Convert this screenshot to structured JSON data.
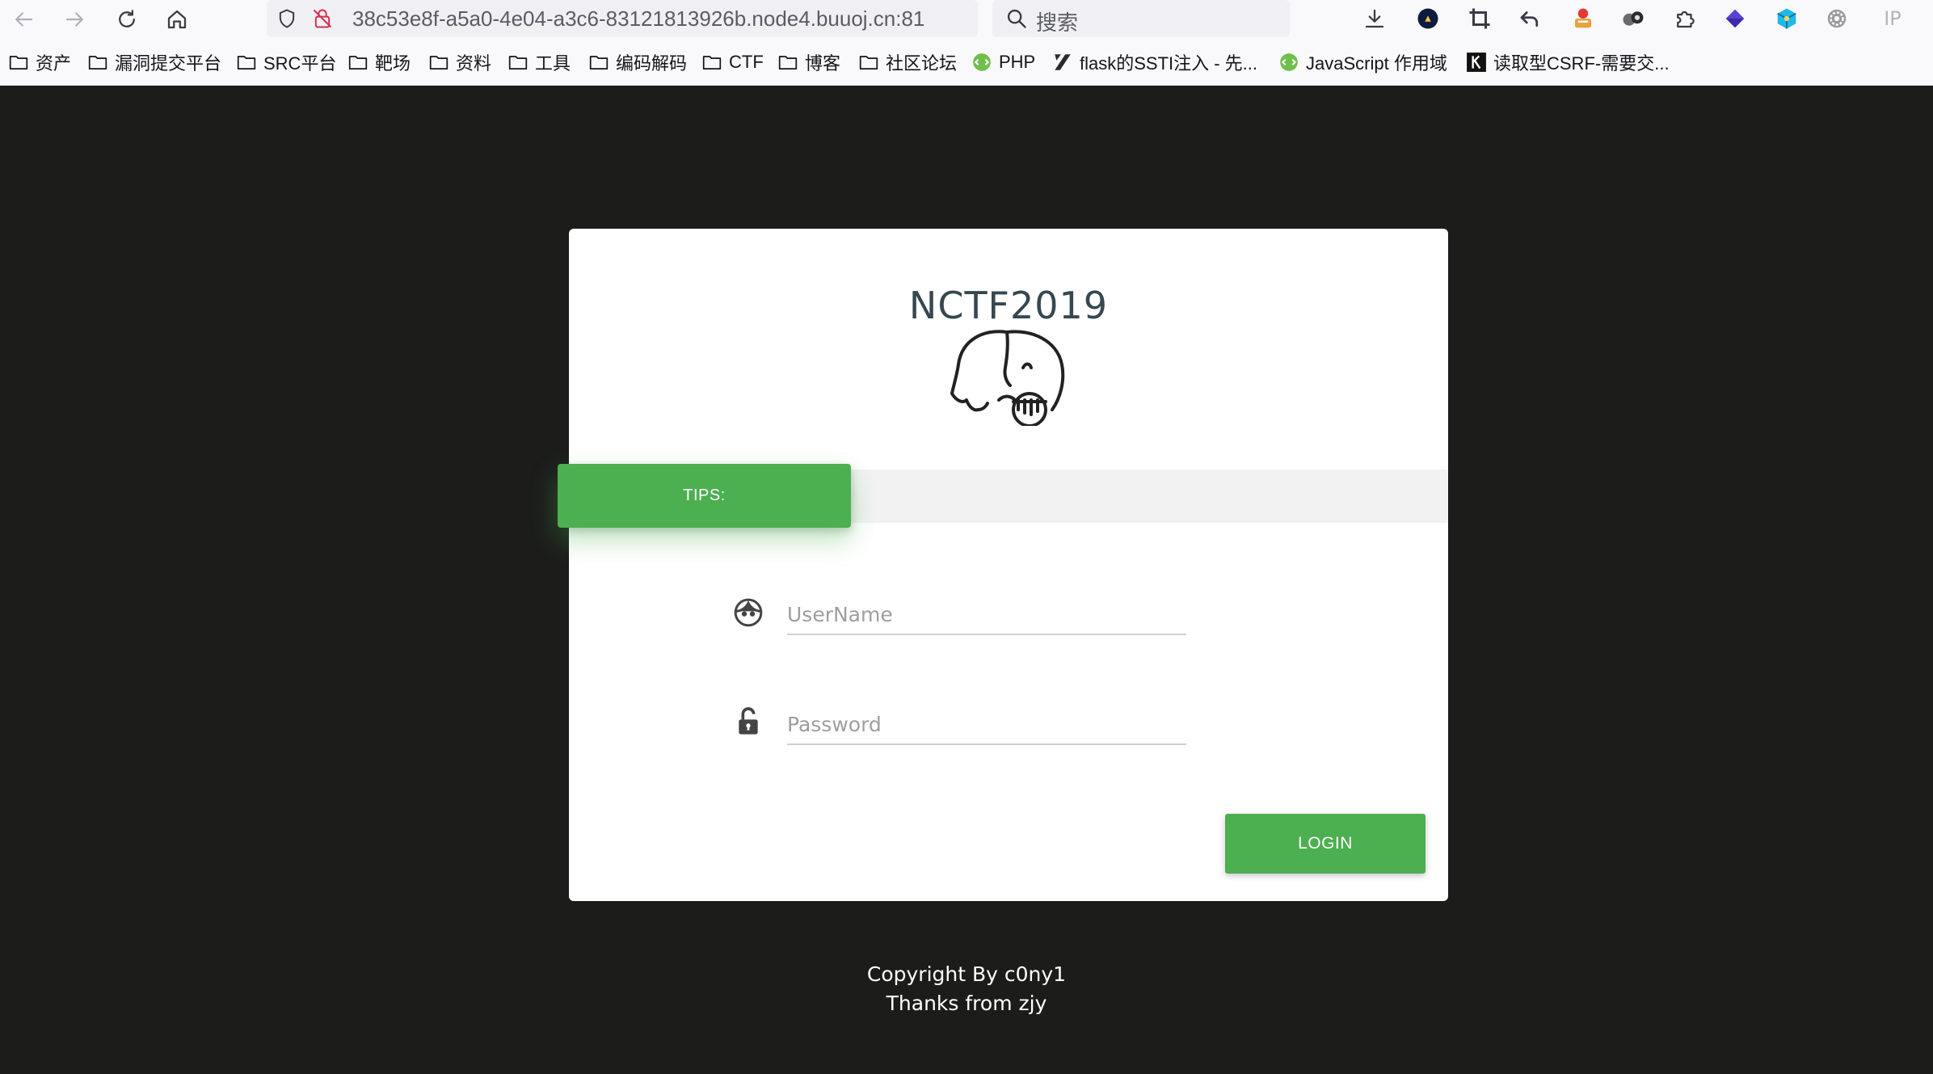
{
  "browser": {
    "url": "38c53e8f-a5a0-4e04-a3c6-83121813926b.node4.buuoj.cn:81",
    "search_placeholder": "搜索",
    "ext_ip_label": "IP",
    "icons": {
      "back": "back-arrow-icon",
      "forward": "forward-arrow-icon",
      "reload": "reload-icon",
      "home": "home-icon",
      "shield": "shield-icon",
      "insecure": "insecure-lock-icon",
      "qr": "qr-code-icon",
      "globe": "globe-icon",
      "star": "bookmark-star-icon",
      "download": "download-icon"
    }
  },
  "bookmarks": [
    {
      "label": "资产",
      "icon": "folder-icon"
    },
    {
      "label": "漏洞提交平台",
      "icon": "folder-icon"
    },
    {
      "label": "SRC平台",
      "icon": "folder-icon"
    },
    {
      "label": "靶场",
      "icon": "folder-icon"
    },
    {
      "label": "资料",
      "icon": "folder-icon"
    },
    {
      "label": "工具",
      "icon": "folder-icon"
    },
    {
      "label": "编码解码",
      "icon": "folder-icon"
    },
    {
      "label": "CTF",
      "icon": "folder-icon"
    },
    {
      "label": "博客",
      "icon": "folder-icon"
    },
    {
      "label": "社区论坛",
      "icon": "folder-icon"
    },
    {
      "label": "PHP",
      "icon": "php-site-icon"
    },
    {
      "label": "flask的SSTI注入 - 先...",
      "icon": "xz-site-icon"
    },
    {
      "label": "JavaScript 作用域",
      "icon": "runoob-site-icon"
    },
    {
      "label": "读取型CSRF-需要交...",
      "icon": "k-site-icon"
    }
  ],
  "page": {
    "title": "NCTF2019",
    "logo_icon": "elephant-logo-icon",
    "tips_label": "TIPS:",
    "username_placeholder": "UserName",
    "password_placeholder": "Password",
    "login_label": "LOGIN",
    "footer_line1": "Copyright By c0ny1",
    "footer_line2": "Thanks from zjy",
    "accent_color": "#4caf50",
    "background_color": "#1c1d1b"
  }
}
